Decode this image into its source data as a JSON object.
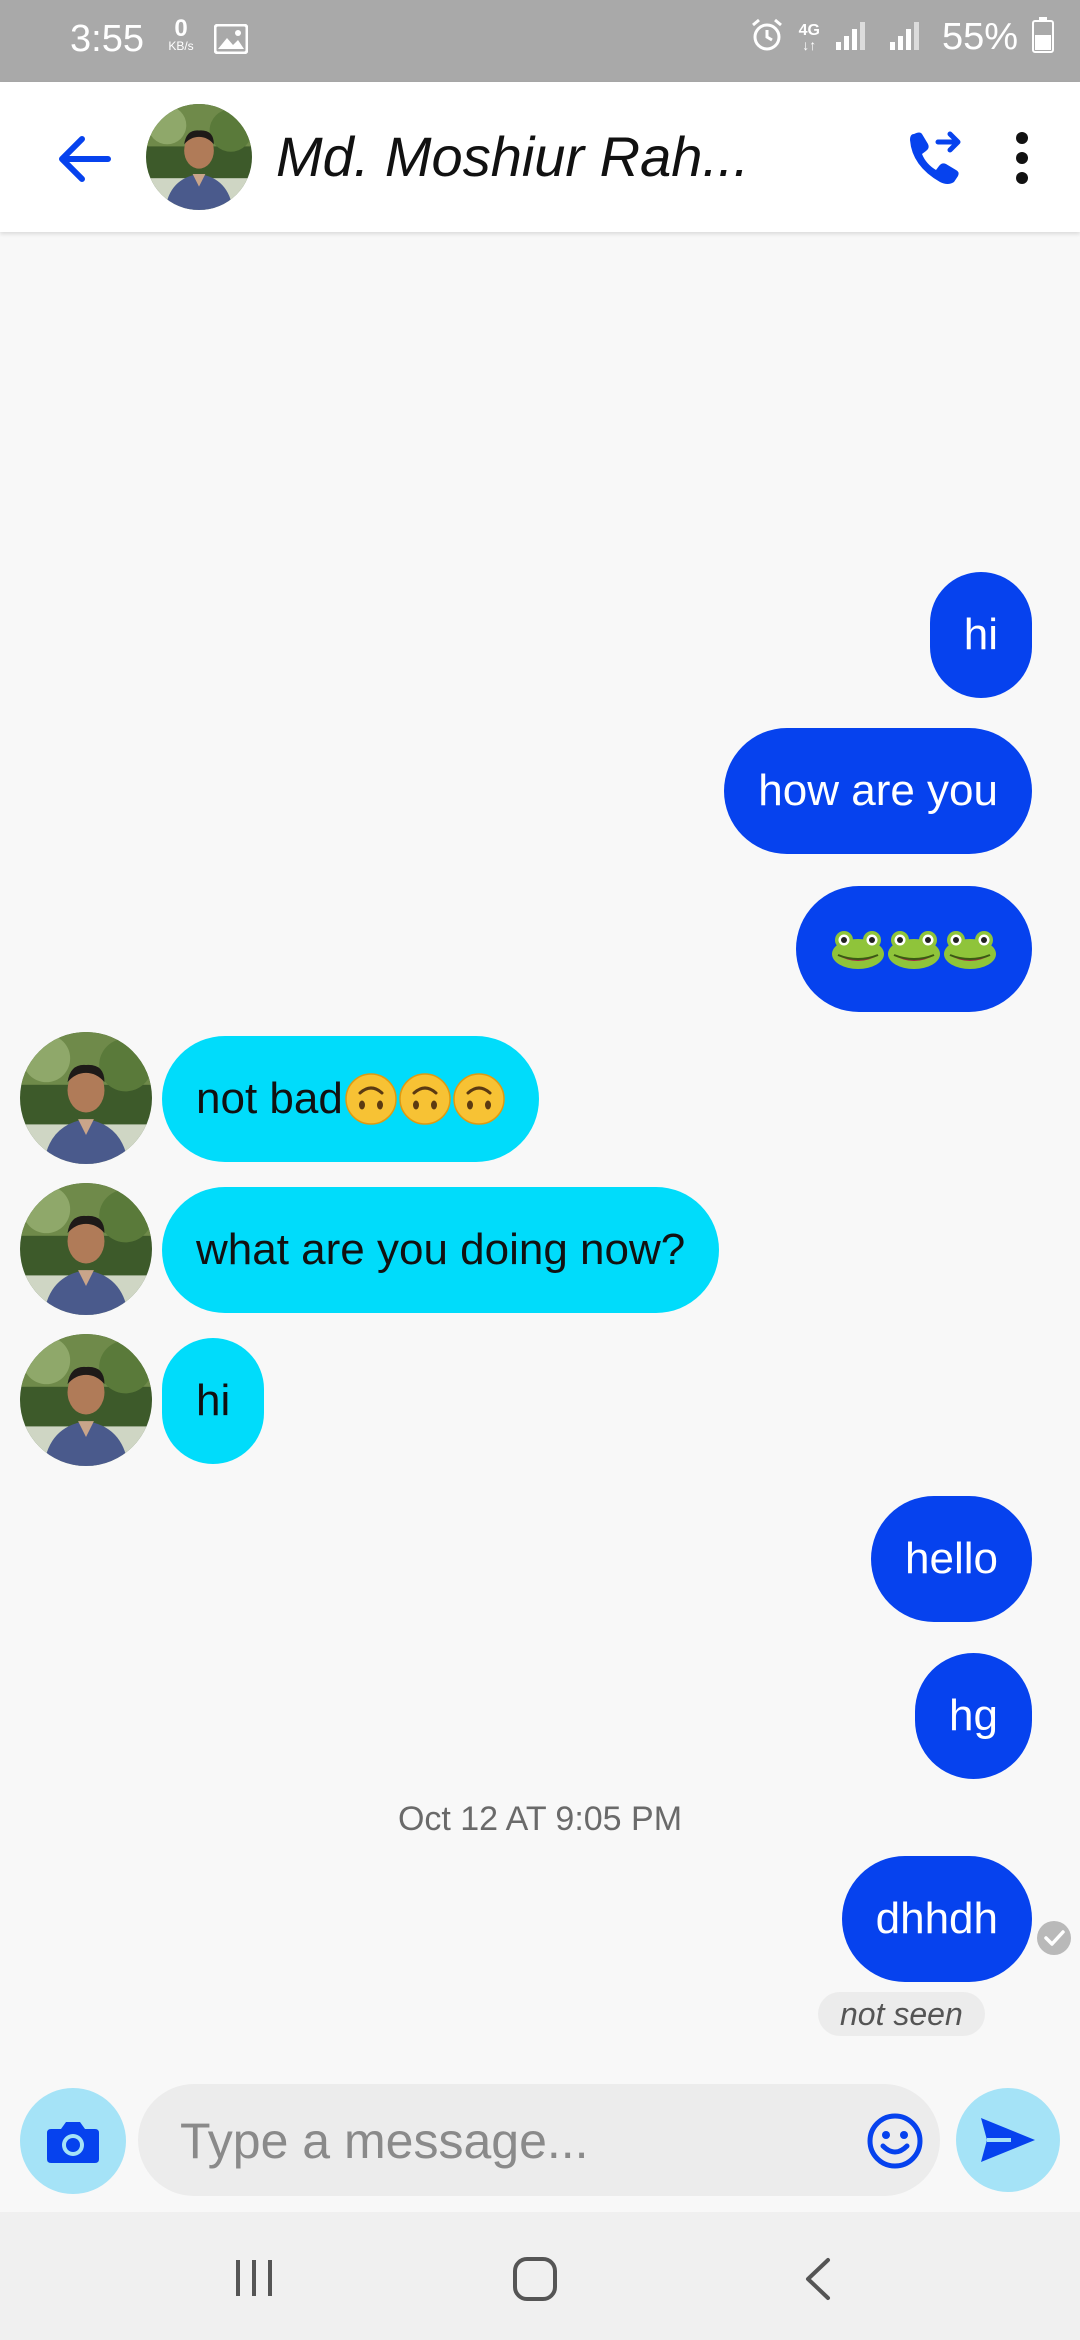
{
  "status_bar": {
    "time": "3:55",
    "data_speed": "0",
    "data_speed_unit": "KB/s",
    "network": "4G",
    "battery": "55%"
  },
  "header": {
    "contact_name": "Md. Moshiur Rah..."
  },
  "messages": [
    {
      "from": "me",
      "text": "hi"
    },
    {
      "from": "me",
      "text": "how are you"
    },
    {
      "from": "me",
      "emoji": "frog-face",
      "count": 3
    },
    {
      "from": "contact",
      "text": "not bad",
      "emoji": "upside-down-face",
      "count": 3
    },
    {
      "from": "contact",
      "text": "what are you doing now?"
    },
    {
      "from": "contact",
      "text": "hi"
    },
    {
      "from": "me",
      "text": "hello"
    },
    {
      "from": "me",
      "text": "hg"
    },
    {
      "from": "me",
      "text": "dhhdh"
    }
  ],
  "timestamp": "Oct 12 AT 9:05 PM",
  "status_label": "not seen",
  "composer": {
    "placeholder": "Type a message..."
  },
  "colors": {
    "sent_bubble": "#0642ee",
    "received_bubble": "#00dcfb",
    "accent": "#0642ee",
    "status_bar": "#a9a9a9"
  }
}
